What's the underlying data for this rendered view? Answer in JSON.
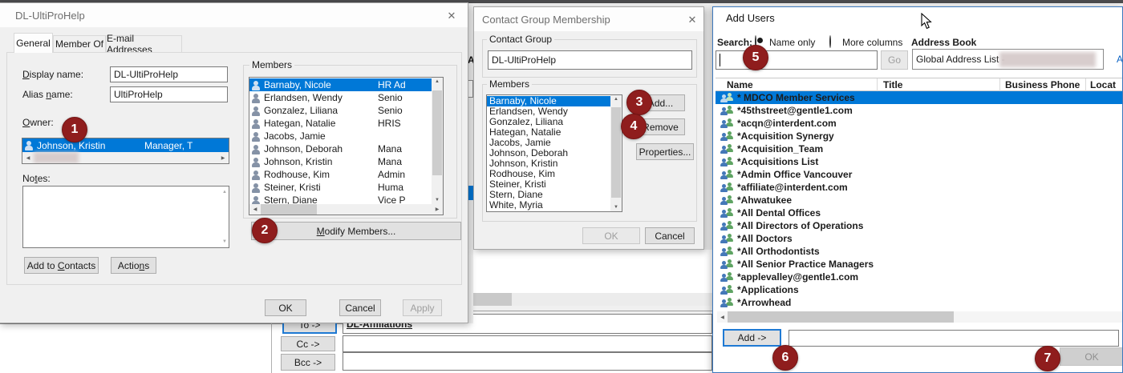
{
  "icons": {
    "close": "✕",
    "scroll_up": "▲",
    "scroll_down": "▼",
    "scroll_left": "◀",
    "scroll_right": "▶"
  },
  "annotations": [
    "1",
    "2",
    "3",
    "4",
    "5",
    "6",
    "7"
  ],
  "background": {
    "to_button": "To ->",
    "to_value": "DL-Affiliations",
    "cc_button": "Cc ->",
    "bcc_button": "Bcc ->",
    "sliver_fragment": "A"
  },
  "colors": {
    "selection": "#0078d7",
    "annotation": "#8f1d1d",
    "focus_border": "#1f7ad4"
  },
  "dl_dialog": {
    "title": "DL-UltiProHelp",
    "tabs": [
      "General",
      "Member Of",
      "E-mail Addresses"
    ],
    "display_name_label": {
      "text": "Display name:",
      "m": 0
    },
    "display_name_value": "DL-UltiProHelp",
    "alias_label": {
      "text": "Alias name:",
      "m": 6
    },
    "alias_value": "UltiProHelp",
    "owner_label": {
      "text": "Owner:",
      "m": 0
    },
    "owner_name": "Johnson, Kristin",
    "owner_title": "Manager, T",
    "notes_label": {
      "text": "Notes:",
      "m": 2
    },
    "members_label": "Members",
    "members": [
      {
        "name": "Barnaby, Nicole",
        "title": "HR Ad"
      },
      {
        "name": "Erlandsen, Wendy",
        "title": "Senio"
      },
      {
        "name": "Gonzalez, Liliana",
        "title": "Senio"
      },
      {
        "name": "Hategan, Natalie",
        "title": "HRIS"
      },
      {
        "name": "Jacobs, Jamie",
        "title": ""
      },
      {
        "name": "Johnson, Deborah",
        "title": "Mana"
      },
      {
        "name": "Johnson, Kristin",
        "title": "Mana"
      },
      {
        "name": "Rodhouse, Kim",
        "title": "Admin"
      },
      {
        "name": "Steiner, Kristi",
        "title": "Huma"
      },
      {
        "name": "Stern, Diane",
        "title": "Vice P"
      }
    ],
    "modify_members": {
      "text": "Modify Members...",
      "m": 0
    },
    "add_to_contacts": {
      "text": "Add to Contacts",
      "m": 7
    },
    "actions": {
      "text": "Actions",
      "m": 5
    },
    "ok": "OK",
    "cancel": "Cancel",
    "apply": "Apply"
  },
  "cgm_dialog": {
    "title": "Contact Group Membership",
    "contact_group_label": "Contact Group",
    "contact_group_value": "DL-UltiProHelp",
    "members_label": "Members",
    "members": [
      "Barnaby, Nicole",
      "Erlandsen, Wendy",
      "Gonzalez, Liliana",
      "Hategan, Natalie",
      "Jacobs, Jamie",
      "Johnson, Deborah",
      "Johnson, Kristin",
      "Rodhouse, Kim",
      "Steiner, Kristi",
      "Stern, Diane",
      "White, Myria"
    ],
    "add": "Add...",
    "remove": "Remove",
    "properties": "Properties...",
    "ok": "OK",
    "cancel": "Cancel"
  },
  "add_users_dialog": {
    "title": "Add Users",
    "search_label": "Search:",
    "radio_name_only": "Name only",
    "radio_more_columns": "More columns",
    "address_book_label": "Address Book",
    "address_book_value": "Global Address List -",
    "go": "Go",
    "advanced_fragment": "A",
    "columns": [
      "Name",
      "Title",
      "Business Phone",
      "Locat"
    ],
    "entries": [
      "* MDCO Member Services",
      "*45thstreet@gentle1.com",
      "*acqn@interdent.com",
      "*Acquisition Synergy",
      "*Acquisition_Team",
      "*Acquisitions List",
      "*Admin Office Vancouver",
      "*affiliate@interdent.com",
      "*Ahwatukee",
      "*All Dental Offices",
      "*All Directors of Operations",
      "*All Doctors",
      "*All Orthodontists",
      "*All Senior Practice Managers",
      "*applevalley@gentle1.com",
      "*Applications",
      "*Arrowhead"
    ],
    "add_button": "Add ->",
    "ok": "OK"
  }
}
